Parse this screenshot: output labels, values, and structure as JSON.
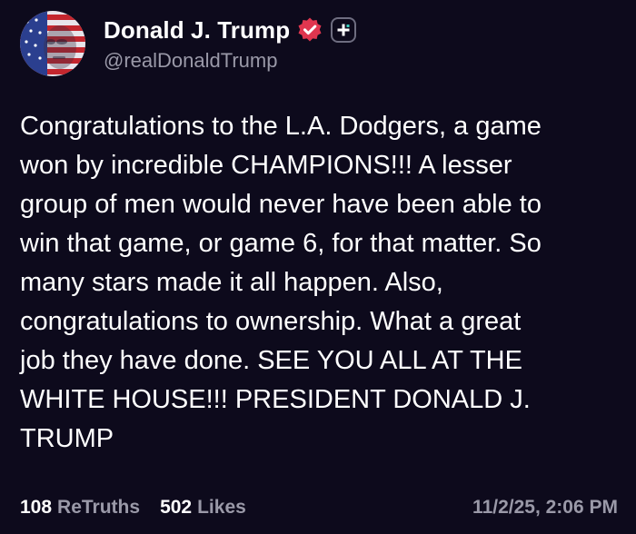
{
  "author": {
    "display_name": "Donald J. Trump",
    "handle": "@realDonaldTrump",
    "avatar_icon": "flag-face-avatar",
    "verified_icon": "verified-badge-icon",
    "follow_icon": "plus-icon"
  },
  "post": {
    "text": "Congratulations to the L.A. Dodgers, a game\nwon by incredible CHAMPIONS!!! A lesser\ngroup of men would never have been able to\nwin that game, or game 6, for that matter. So\nmany stars made it all happen. Also,\ncongratulations to ownership. What a great\njob they have done. SEE YOU ALL AT THE\nWHITE HOUSE!!! PRESIDENT DONALD J.\nTRUMP"
  },
  "stats": {
    "retruths_count": "108",
    "retruths_label": "ReTruths",
    "likes_count": "502",
    "likes_label": "Likes",
    "timestamp": "11/2/25, 2:06 PM"
  },
  "colors": {
    "background": "#0d0a1c",
    "text": "#ffffff",
    "muted": "#9a99a8",
    "verified": "#e0364f"
  }
}
